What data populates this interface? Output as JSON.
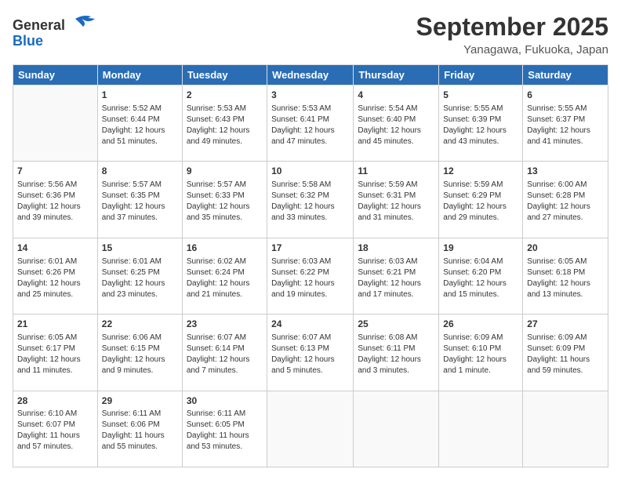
{
  "logo": {
    "line1": "General",
    "line2": "Blue"
  },
  "header": {
    "month": "September 2025",
    "location": "Yanagawa, Fukuoka, Japan"
  },
  "days_of_week": [
    "Sunday",
    "Monday",
    "Tuesday",
    "Wednesday",
    "Thursday",
    "Friday",
    "Saturday"
  ],
  "weeks": [
    [
      {
        "day": "",
        "info": ""
      },
      {
        "day": "1",
        "info": "Sunrise: 5:52 AM\nSunset: 6:44 PM\nDaylight: 12 hours\nand 51 minutes."
      },
      {
        "day": "2",
        "info": "Sunrise: 5:53 AM\nSunset: 6:43 PM\nDaylight: 12 hours\nand 49 minutes."
      },
      {
        "day": "3",
        "info": "Sunrise: 5:53 AM\nSunset: 6:41 PM\nDaylight: 12 hours\nand 47 minutes."
      },
      {
        "day": "4",
        "info": "Sunrise: 5:54 AM\nSunset: 6:40 PM\nDaylight: 12 hours\nand 45 minutes."
      },
      {
        "day": "5",
        "info": "Sunrise: 5:55 AM\nSunset: 6:39 PM\nDaylight: 12 hours\nand 43 minutes."
      },
      {
        "day": "6",
        "info": "Sunrise: 5:55 AM\nSunset: 6:37 PM\nDaylight: 12 hours\nand 41 minutes."
      }
    ],
    [
      {
        "day": "7",
        "info": "Sunrise: 5:56 AM\nSunset: 6:36 PM\nDaylight: 12 hours\nand 39 minutes."
      },
      {
        "day": "8",
        "info": "Sunrise: 5:57 AM\nSunset: 6:35 PM\nDaylight: 12 hours\nand 37 minutes."
      },
      {
        "day": "9",
        "info": "Sunrise: 5:57 AM\nSunset: 6:33 PM\nDaylight: 12 hours\nand 35 minutes."
      },
      {
        "day": "10",
        "info": "Sunrise: 5:58 AM\nSunset: 6:32 PM\nDaylight: 12 hours\nand 33 minutes."
      },
      {
        "day": "11",
        "info": "Sunrise: 5:59 AM\nSunset: 6:31 PM\nDaylight: 12 hours\nand 31 minutes."
      },
      {
        "day": "12",
        "info": "Sunrise: 5:59 AM\nSunset: 6:29 PM\nDaylight: 12 hours\nand 29 minutes."
      },
      {
        "day": "13",
        "info": "Sunrise: 6:00 AM\nSunset: 6:28 PM\nDaylight: 12 hours\nand 27 minutes."
      }
    ],
    [
      {
        "day": "14",
        "info": "Sunrise: 6:01 AM\nSunset: 6:26 PM\nDaylight: 12 hours\nand 25 minutes."
      },
      {
        "day": "15",
        "info": "Sunrise: 6:01 AM\nSunset: 6:25 PM\nDaylight: 12 hours\nand 23 minutes."
      },
      {
        "day": "16",
        "info": "Sunrise: 6:02 AM\nSunset: 6:24 PM\nDaylight: 12 hours\nand 21 minutes."
      },
      {
        "day": "17",
        "info": "Sunrise: 6:03 AM\nSunset: 6:22 PM\nDaylight: 12 hours\nand 19 minutes."
      },
      {
        "day": "18",
        "info": "Sunrise: 6:03 AM\nSunset: 6:21 PM\nDaylight: 12 hours\nand 17 minutes."
      },
      {
        "day": "19",
        "info": "Sunrise: 6:04 AM\nSunset: 6:20 PM\nDaylight: 12 hours\nand 15 minutes."
      },
      {
        "day": "20",
        "info": "Sunrise: 6:05 AM\nSunset: 6:18 PM\nDaylight: 12 hours\nand 13 minutes."
      }
    ],
    [
      {
        "day": "21",
        "info": "Sunrise: 6:05 AM\nSunset: 6:17 PM\nDaylight: 12 hours\nand 11 minutes."
      },
      {
        "day": "22",
        "info": "Sunrise: 6:06 AM\nSunset: 6:15 PM\nDaylight: 12 hours\nand 9 minutes."
      },
      {
        "day": "23",
        "info": "Sunrise: 6:07 AM\nSunset: 6:14 PM\nDaylight: 12 hours\nand 7 minutes."
      },
      {
        "day": "24",
        "info": "Sunrise: 6:07 AM\nSunset: 6:13 PM\nDaylight: 12 hours\nand 5 minutes."
      },
      {
        "day": "25",
        "info": "Sunrise: 6:08 AM\nSunset: 6:11 PM\nDaylight: 12 hours\nand 3 minutes."
      },
      {
        "day": "26",
        "info": "Sunrise: 6:09 AM\nSunset: 6:10 PM\nDaylight: 12 hours\nand 1 minute."
      },
      {
        "day": "27",
        "info": "Sunrise: 6:09 AM\nSunset: 6:09 PM\nDaylight: 11 hours\nand 59 minutes."
      }
    ],
    [
      {
        "day": "28",
        "info": "Sunrise: 6:10 AM\nSunset: 6:07 PM\nDaylight: 11 hours\nand 57 minutes."
      },
      {
        "day": "29",
        "info": "Sunrise: 6:11 AM\nSunset: 6:06 PM\nDaylight: 11 hours\nand 55 minutes."
      },
      {
        "day": "30",
        "info": "Sunrise: 6:11 AM\nSunset: 6:05 PM\nDaylight: 11 hours\nand 53 minutes."
      },
      {
        "day": "",
        "info": ""
      },
      {
        "day": "",
        "info": ""
      },
      {
        "day": "",
        "info": ""
      },
      {
        "day": "",
        "info": ""
      }
    ]
  ]
}
